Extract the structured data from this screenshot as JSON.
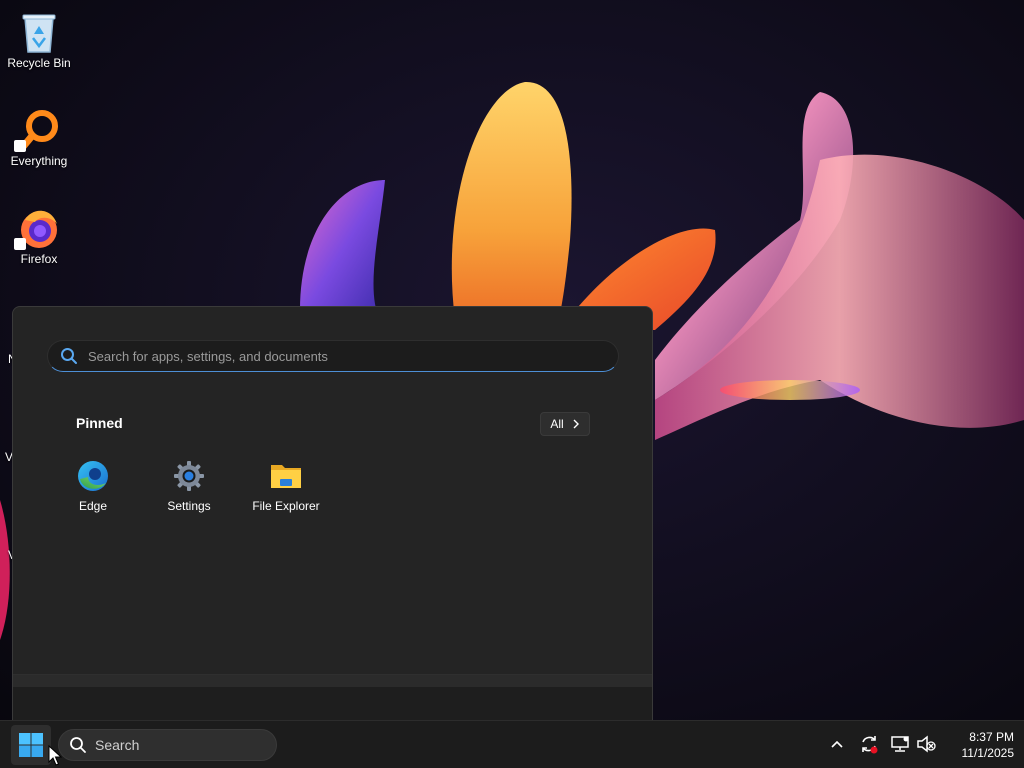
{
  "desktop": {
    "icons": [
      {
        "label": "Recycle Bin",
        "icon": "recycle-bin-icon"
      },
      {
        "label": "Everything",
        "icon": "everything-search-icon"
      },
      {
        "label": "Firefox",
        "icon": "firefox-icon"
      }
    ],
    "partial_labels": [
      "N",
      "V",
      "V"
    ]
  },
  "start_menu": {
    "search": {
      "placeholder": "Search for apps, settings, and documents",
      "value": ""
    },
    "pinned_title": "Pinned",
    "all_button": {
      "label": "All",
      "icon": "chevron-right-icon"
    },
    "pinned_apps": [
      {
        "label": "Edge",
        "icon": "edge-icon"
      },
      {
        "label": "Settings",
        "icon": "settings-gear-icon"
      },
      {
        "label": "File Explorer",
        "icon": "folder-icon"
      }
    ]
  },
  "taskbar": {
    "start_icon": "windows-logo-icon",
    "search_label": "Search",
    "tray": [
      {
        "icon": "chevron-up-icon"
      },
      {
        "icon": "sync-icon"
      },
      {
        "icon": "network-icon"
      },
      {
        "icon": "volume-muted-icon"
      }
    ],
    "clock": {
      "time": "8:37 PM",
      "date": "11/1/2025"
    }
  },
  "colors": {
    "accent": "#4d8fd6",
    "menu_bg": "#242424",
    "taskbar_bg": "#1c1c1c"
  }
}
